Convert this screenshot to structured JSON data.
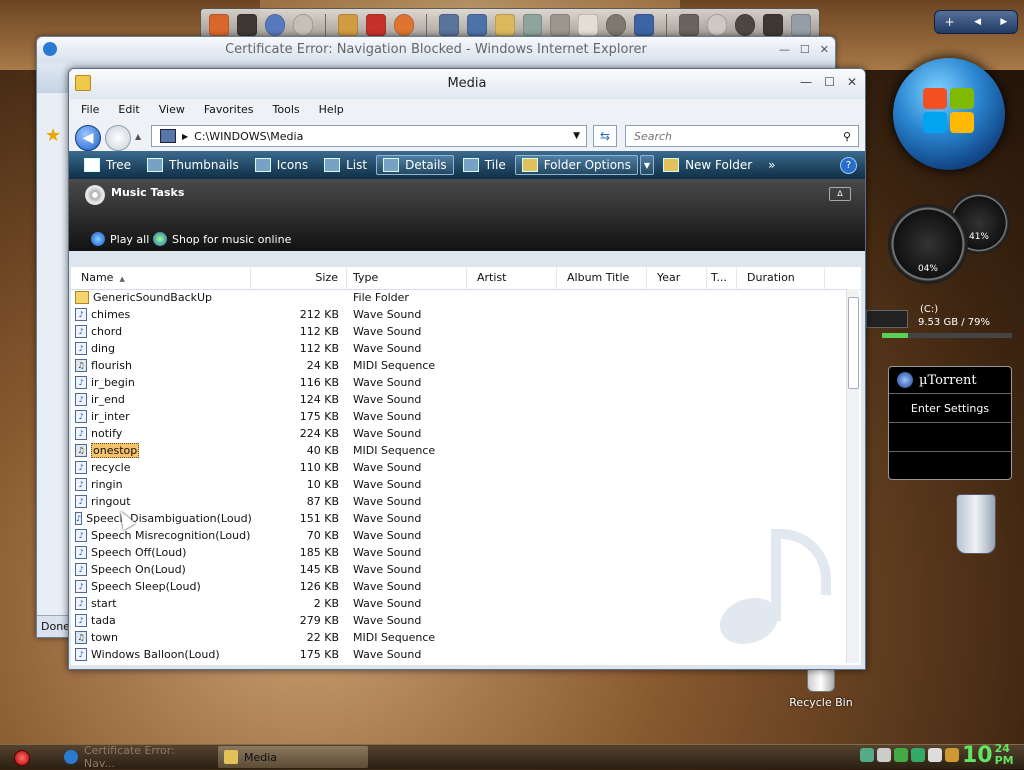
{
  "ie_window": {
    "title": "Certificate Error: Navigation Blocked - Windows Internet Explorer",
    "status": "Done"
  },
  "window": {
    "title": "Media",
    "menu": [
      "File",
      "Edit",
      "View",
      "Favorites",
      "Tools",
      "Help"
    ],
    "address": "C:\\WINDOWS\\Media",
    "search_placeholder": "Search",
    "toolbar": {
      "tree": "Tree",
      "thumbnails": "Thumbnails",
      "icons": "Icons",
      "list": "List",
      "details": "Details",
      "tile": "Tile",
      "folder_options": "Folder Options",
      "new_folder": "New Folder",
      "more": "»"
    },
    "tasks": {
      "heading": "Music Tasks",
      "play_all": "Play all",
      "shop": "Shop for music online"
    },
    "columns": {
      "name": "Name",
      "size": "Size",
      "type": "Type",
      "artist": "Artist",
      "album": "Album Title",
      "year": "Year",
      "track": "T...",
      "duration": "Duration"
    },
    "files": [
      {
        "name": "GenericSoundBackUp",
        "size": "",
        "type": "File Folder",
        "kind": "folder"
      },
      {
        "name": "chimes",
        "size": "212 KB",
        "type": "Wave Sound",
        "kind": "wave"
      },
      {
        "name": "chord",
        "size": "112 KB",
        "type": "Wave Sound",
        "kind": "wave"
      },
      {
        "name": "ding",
        "size": "112 KB",
        "type": "Wave Sound",
        "kind": "wave"
      },
      {
        "name": "flourish",
        "size": "24 KB",
        "type": "MIDI Sequence",
        "kind": "midi"
      },
      {
        "name": "ir_begin",
        "size": "116 KB",
        "type": "Wave Sound",
        "kind": "wave"
      },
      {
        "name": "ir_end",
        "size": "124 KB",
        "type": "Wave Sound",
        "kind": "wave"
      },
      {
        "name": "ir_inter",
        "size": "175 KB",
        "type": "Wave Sound",
        "kind": "wave"
      },
      {
        "name": "notify",
        "size": "224 KB",
        "type": "Wave Sound",
        "kind": "wave"
      },
      {
        "name": "onestop",
        "size": "40 KB",
        "type": "MIDI Sequence",
        "kind": "midi",
        "selected": true
      },
      {
        "name": "recycle",
        "size": "110 KB",
        "type": "Wave Sound",
        "kind": "wave"
      },
      {
        "name": "ringin",
        "size": "10 KB",
        "type": "Wave Sound",
        "kind": "wave"
      },
      {
        "name": "ringout",
        "size": "87 KB",
        "type": "Wave Sound",
        "kind": "wave"
      },
      {
        "name": "Speech Disambiguation(Loud)",
        "size": "151 KB",
        "type": "Wave Sound",
        "kind": "wave"
      },
      {
        "name": "Speech Misrecognition(Loud)",
        "size": "70 KB",
        "type": "Wave Sound",
        "kind": "wave"
      },
      {
        "name": "Speech Off(Loud)",
        "size": "185 KB",
        "type": "Wave Sound",
        "kind": "wave"
      },
      {
        "name": "Speech On(Loud)",
        "size": "145 KB",
        "type": "Wave Sound",
        "kind": "wave"
      },
      {
        "name": "Speech Sleep(Loud)",
        "size": "126 KB",
        "type": "Wave Sound",
        "kind": "wave"
      },
      {
        "name": "start",
        "size": "2 KB",
        "type": "Wave Sound",
        "kind": "wave"
      },
      {
        "name": "tada",
        "size": "279 KB",
        "type": "Wave Sound",
        "kind": "wave"
      },
      {
        "name": "town",
        "size": "22 KB",
        "type": "MIDI Sequence",
        "kind": "midi"
      },
      {
        "name": "Windows Balloon(Loud)",
        "size": "175 KB",
        "type": "Wave Sound",
        "kind": "wave"
      }
    ]
  },
  "gadgets": {
    "cpu_gauge": "04%",
    "mem_gauge": "41%",
    "drive_name": "(C:)",
    "drive_space": "9.53 GB / 79%",
    "drive_used_fraction": 0.2,
    "utorrent_title": "µTorrent",
    "utorrent_settings": "Enter Settings"
  },
  "desktop": {
    "recycle_bin": "Recycle Bin"
  },
  "taskbar": {
    "items": [
      {
        "label": "Certificate Error: Nav...",
        "active": false
      },
      {
        "label": "Media",
        "active": true
      }
    ],
    "clock_hour": "10",
    "clock_min": "24",
    "clock_ampm": "PM"
  },
  "colors": {
    "selection": "#f4c36b",
    "command_bar": "#1f4a68",
    "clock": "#63e463"
  }
}
